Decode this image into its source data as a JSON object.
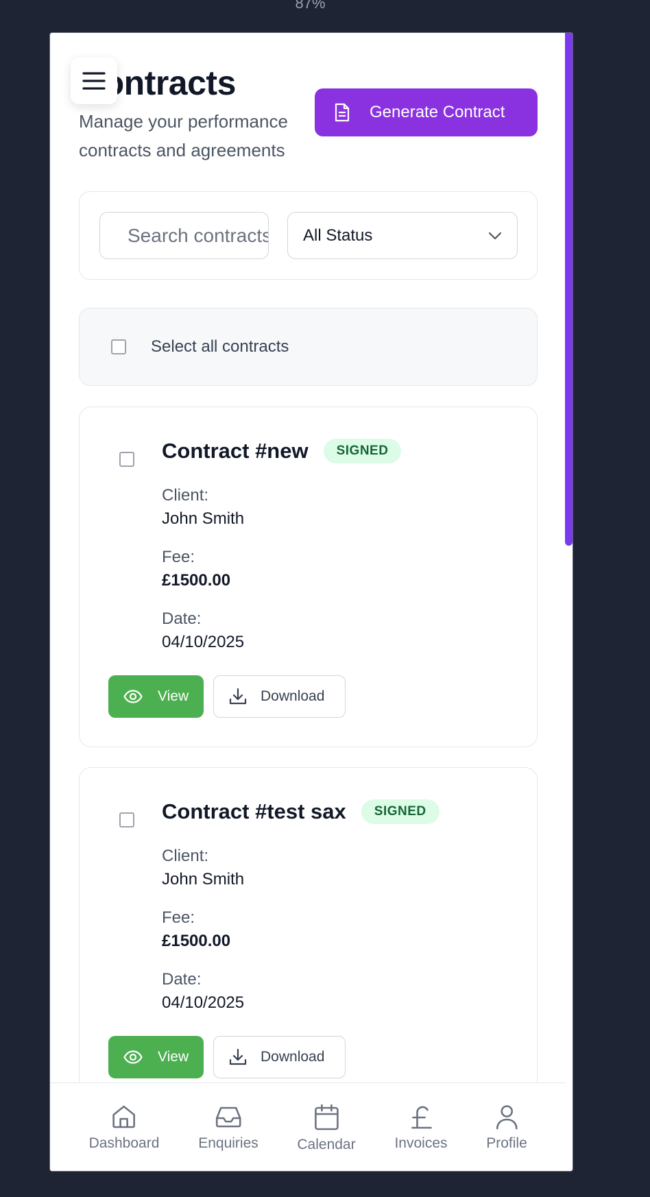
{
  "browser": {
    "zoom": "87%"
  },
  "header": {
    "title": "Contracts",
    "subtitle": "Manage your performance contracts and agreements",
    "generate_button": "Generate Contract"
  },
  "filters": {
    "search_placeholder": "Search contracts...",
    "status_selected": "All Status"
  },
  "select_all_label": "Select all contracts",
  "field_labels": {
    "client": "Client:",
    "fee": "Fee:",
    "date": "Date:"
  },
  "actions": {
    "view": "View",
    "download": "Download"
  },
  "contracts": [
    {
      "title": "Contract #new",
      "status": "SIGNED",
      "client": "John Smith",
      "fee": "£1500.00",
      "date": "04/10/2025"
    },
    {
      "title": "Contract #test sax",
      "status": "SIGNED",
      "client": "John Smith",
      "fee": "£1500.00",
      "date": "04/10/2025"
    }
  ],
  "nav": [
    {
      "label": "Dashboard",
      "icon": "home-icon"
    },
    {
      "label": "Enquiries",
      "icon": "inbox-icon"
    },
    {
      "label": "Calendar",
      "icon": "calendar-icon"
    },
    {
      "label": "Invoices",
      "icon": "pound-icon"
    },
    {
      "label": "Profile",
      "icon": "user-icon"
    }
  ],
  "colors": {
    "primary": "#8b32e0",
    "success": "#4caf50",
    "badge_bg": "#dcfce7",
    "badge_text": "#166534"
  }
}
